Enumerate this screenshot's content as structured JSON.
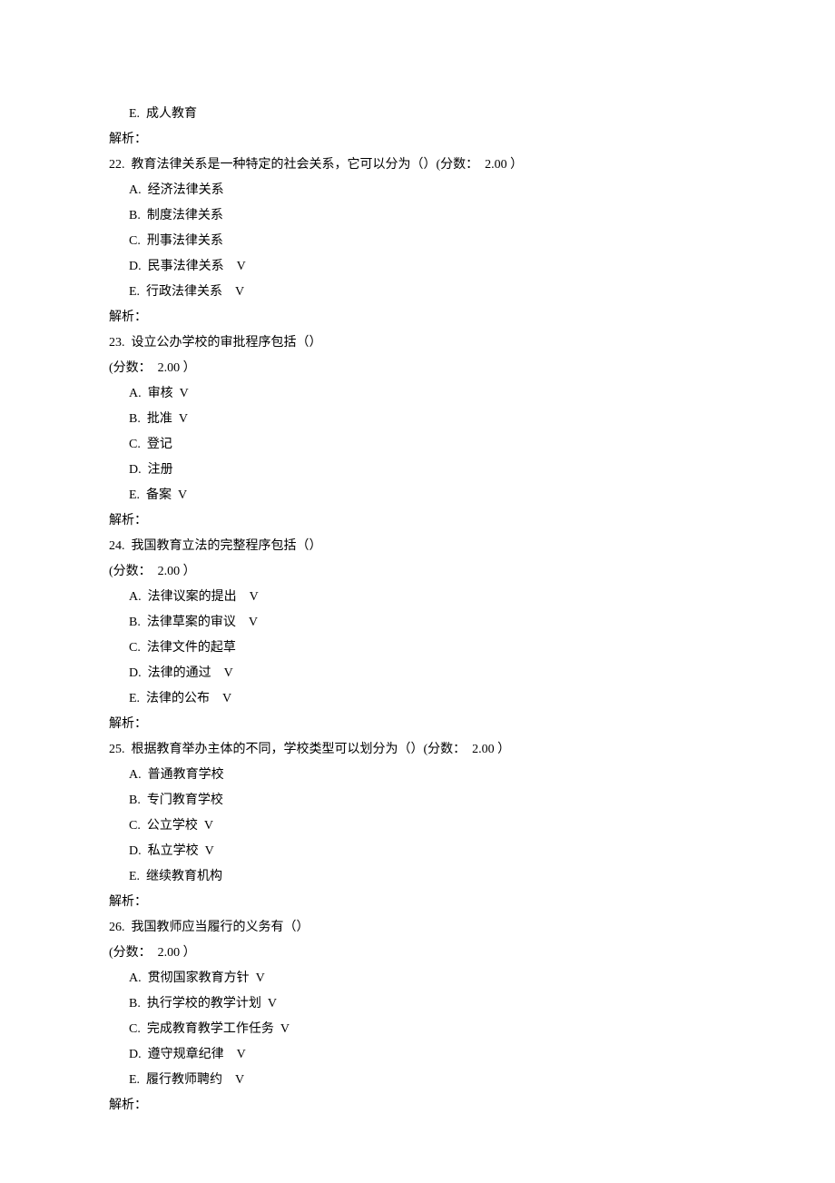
{
  "lines": [
    {
      "cls": "indent-1",
      "t": "E.  成人教育"
    },
    {
      "cls": "",
      "t": "解析："
    },
    {
      "cls": "",
      "t": "22.  教育法律关系是一种特定的社会关系，它可以分为（）(分数：  2.00 ）"
    },
    {
      "cls": "indent-1",
      "t": "A.  经济法律关系"
    },
    {
      "cls": "indent-1",
      "t": "B.  制度法律关系"
    },
    {
      "cls": "indent-1",
      "t": "C.  刑事法律关系"
    },
    {
      "cls": "indent-1",
      "t": "D.  民事法律关系    V"
    },
    {
      "cls": "indent-1",
      "t": "E.  行政法律关系    V"
    },
    {
      "cls": "",
      "t": "解析："
    },
    {
      "cls": "",
      "t": "23.  设立公办学校的审批程序包括（）"
    },
    {
      "cls": "",
      "t": "(分数：  2.00 ）"
    },
    {
      "cls": "indent-1",
      "t": "A.  审核  V"
    },
    {
      "cls": "indent-1",
      "t": "B.  批准  V"
    },
    {
      "cls": "indent-1",
      "t": "C.  登记"
    },
    {
      "cls": "indent-1",
      "t": "D.  注册"
    },
    {
      "cls": "indent-1",
      "t": "E.  备案  V"
    },
    {
      "cls": "",
      "t": "解析："
    },
    {
      "cls": "",
      "t": "24.  我国教育立法的完整程序包括（）"
    },
    {
      "cls": "",
      "t": "(分数：  2.00 ）"
    },
    {
      "cls": "indent-1",
      "t": "A.  法律议案的提出    V"
    },
    {
      "cls": "indent-1",
      "t": "B.  法律草案的审议    V"
    },
    {
      "cls": "indent-1",
      "t": "C.  法律文件的起草"
    },
    {
      "cls": "indent-1",
      "t": "D.  法律的通过    V"
    },
    {
      "cls": "indent-1",
      "t": "E.  法律的公布    V"
    },
    {
      "cls": "",
      "t": "解析："
    },
    {
      "cls": "",
      "t": "25.  根据教育举办主体的不同，学校类型可以划分为（）(分数：  2.00 ）"
    },
    {
      "cls": "indent-1",
      "t": "A.  普通教育学校"
    },
    {
      "cls": "indent-1",
      "t": "B.  专门教育学校"
    },
    {
      "cls": "indent-1",
      "t": "C.  公立学校  V"
    },
    {
      "cls": "indent-1",
      "t": "D.  私立学校  V"
    },
    {
      "cls": "indent-1",
      "t": "E.  继续教育机构"
    },
    {
      "cls": "",
      "t": "解析："
    },
    {
      "cls": "",
      "t": "26.  我国教师应当履行的义务有（）"
    },
    {
      "cls": "",
      "t": "(分数：  2.00 ）"
    },
    {
      "cls": "indent-1",
      "t": "A.  贯彻国家教育方针  V"
    },
    {
      "cls": "indent-1",
      "t": "B.  执行学校的教学计划  V"
    },
    {
      "cls": "indent-1",
      "t": "C.  完成教育教学工作任务  V"
    },
    {
      "cls": "indent-1",
      "t": "D.  遵守规章纪律    V"
    },
    {
      "cls": "indent-1",
      "t": "E.  履行教师聘约    V"
    },
    {
      "cls": "",
      "t": "解析："
    }
  ]
}
